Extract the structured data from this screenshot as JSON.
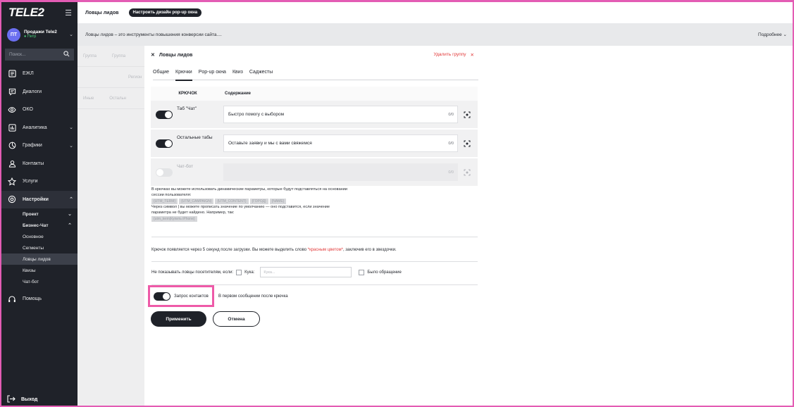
{
  "sidebar": {
    "logo": "TELE2",
    "user": {
      "initials": "ПТ",
      "name": "Продажи Tele2",
      "status": "● Петр"
    },
    "search_placeholder": "Поиск...",
    "items": [
      {
        "label": "ЕЖЛ",
        "icon": "inbox-icon"
      },
      {
        "label": "Диалоги",
        "icon": "chat-icon"
      },
      {
        "label": "ОКО",
        "icon": "eye-icon"
      },
      {
        "label": "Аналитика",
        "icon": "analytics-icon"
      },
      {
        "label": "Графики",
        "icon": "pie-chart-icon"
      },
      {
        "label": "Контакты",
        "icon": "contacts-icon"
      },
      {
        "label": "Услуги",
        "icon": "star-icon"
      },
      {
        "label": "Настройки",
        "icon": "gear-icon"
      }
    ],
    "sub": {
      "project": "Проект",
      "business_chat": "Бизнес-Чат",
      "items": [
        "Основное",
        "Сегменты",
        "Ловцы лидов",
        "Квизы",
        "Чат-бот"
      ]
    },
    "help": "Помощь",
    "exit": "Выход"
  },
  "topbar": {
    "title": "Ловцы лидов",
    "pill": "Настроить дизайн pop-up окна"
  },
  "infobar": {
    "text": "Ловцы лидов – это инструменты повышения конверсии сайта....",
    "more": "Подробнее"
  },
  "behind": {
    "rows": [
      [
        "Группа",
        "Группа"
      ],
      [
        "",
        "Регион"
      ],
      [
        "Иные",
        "Остальн"
      ]
    ]
  },
  "panel": {
    "title": "Ловцы лидов",
    "delete_group": "Удалить группу",
    "tabs": [
      "Общие",
      "Крючки",
      "Pop-up окна",
      "Квиз",
      "Саджесты"
    ],
    "hooks_head": {
      "col1": "КРЮЧОК",
      "col2": "Содержание"
    },
    "hooks": [
      {
        "name": "Таб \"Чат\"",
        "value": "Быстро помогу с выбором",
        "count": "0/0",
        "on": true
      },
      {
        "name": "Остальные табы",
        "value": "Оставьте заявку и мы с вами свяжемся",
        "count": "0/0",
        "on": true
      },
      {
        "name": "Чат-бот",
        "value": "",
        "count": "0/0",
        "on": false
      }
    ],
    "info": {
      "line1": "В крючках вы можете использовать динамические параметры, которые будут подставляться на основании",
      "line2": "сессии пользователя:",
      "tags": [
        "{UTM_TERM}",
        "{UTM_CAMPAIGN}",
        "{UTM_CONTENT}",
        "{ГОРОД}",
        "{NAME}"
      ],
      "line3": "Через символ | вы можете прописать значение по умолчанию — оно подставится, если значение",
      "line4": "параметра не будет найдено. Например, так:",
      "example": "{utm_term|Купить iPhone}"
    },
    "hint": {
      "before": "Крючок появляется через 5 секунд после загрузки. Вы можете выделить слово ",
      "red": "*красным цветом*",
      "after": ", заключив его в звездочки."
    },
    "no_show": {
      "label": "Не показывать ловцы посетителям, если:",
      "cookie": "Кука:",
      "cookie_placeholder": "Кука...",
      "was_request": "Было обращение"
    },
    "contacts": {
      "label": "Запрос контактов",
      "desc": "В первом сообщении после крючка"
    },
    "apply": "Применить",
    "cancel": "Отмена"
  }
}
